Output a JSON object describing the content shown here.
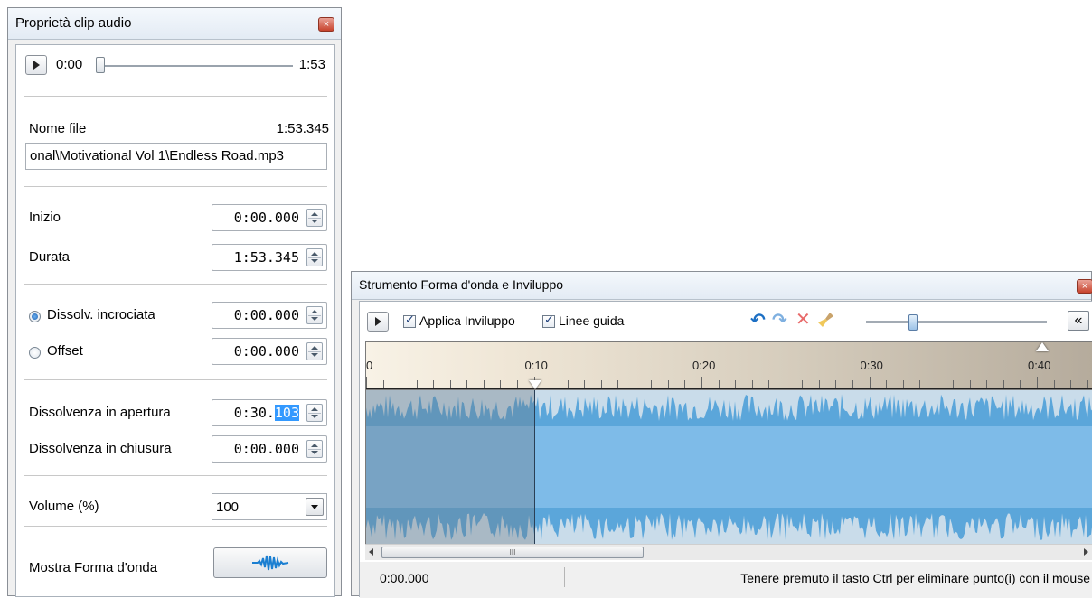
{
  "left_panel": {
    "title": "Proprietà clip audio",
    "close_glyph": "×",
    "player": {
      "time_start": "0:00",
      "time_end": "1:53",
      "position_fraction": 0.0
    },
    "file": {
      "label": "Nome file",
      "duration": "1:53.345",
      "path_value": "onal\\Motivational Vol 1\\Endless Road.mp3"
    },
    "inizio": {
      "label": "Inizio",
      "value": "0:00.000"
    },
    "durata": {
      "label": "Durata",
      "value": "1:53.345"
    },
    "crossfade": {
      "label": "Dissolv. incrociata",
      "value": "0:00.000",
      "selected": true
    },
    "offset": {
      "label": "Offset",
      "value": "0:00.000",
      "selected": false
    },
    "fade_in": {
      "label": "Dissolvenza in apertura",
      "value_prefix": "0:30.",
      "value_selected": "103"
    },
    "fade_out": {
      "label": "Dissolvenza in chiusura",
      "value": "0:00.000"
    },
    "volume": {
      "label": "Volume (%)",
      "value": "100"
    },
    "waveform": {
      "label": "Mostra Forma d'onda",
      "icon": "waveform-icon"
    }
  },
  "right_panel": {
    "title": "Strumento Forma d'onda e Inviluppo",
    "close_glyph": "×",
    "toolbar": {
      "apply_envelope_label": "Applica Inviluppo",
      "apply_envelope_checked": true,
      "guides_label": "Linee guida",
      "guides_checked": true,
      "undo_icon": "undo-icon",
      "redo_icon": "redo-icon",
      "delete_icon": "delete-icon",
      "clear_icon": "broom-icon",
      "zoom_fraction": 0.24,
      "collapse_label": "«"
    },
    "timeline": {
      "labels": [
        "0",
        "0:10",
        "0:20",
        "0:30",
        "0:40"
      ]
    },
    "scroll_grip": "III",
    "status": {
      "time": "0:00.000",
      "hint": "Tenere premuto il tasto Ctrl per eliminare punto(i) con il mouse"
    },
    "colors": {
      "wave": "#5ba6da",
      "wave_bg": "#7ebbe8",
      "fade_overlay": "#8fa6ba"
    }
  }
}
